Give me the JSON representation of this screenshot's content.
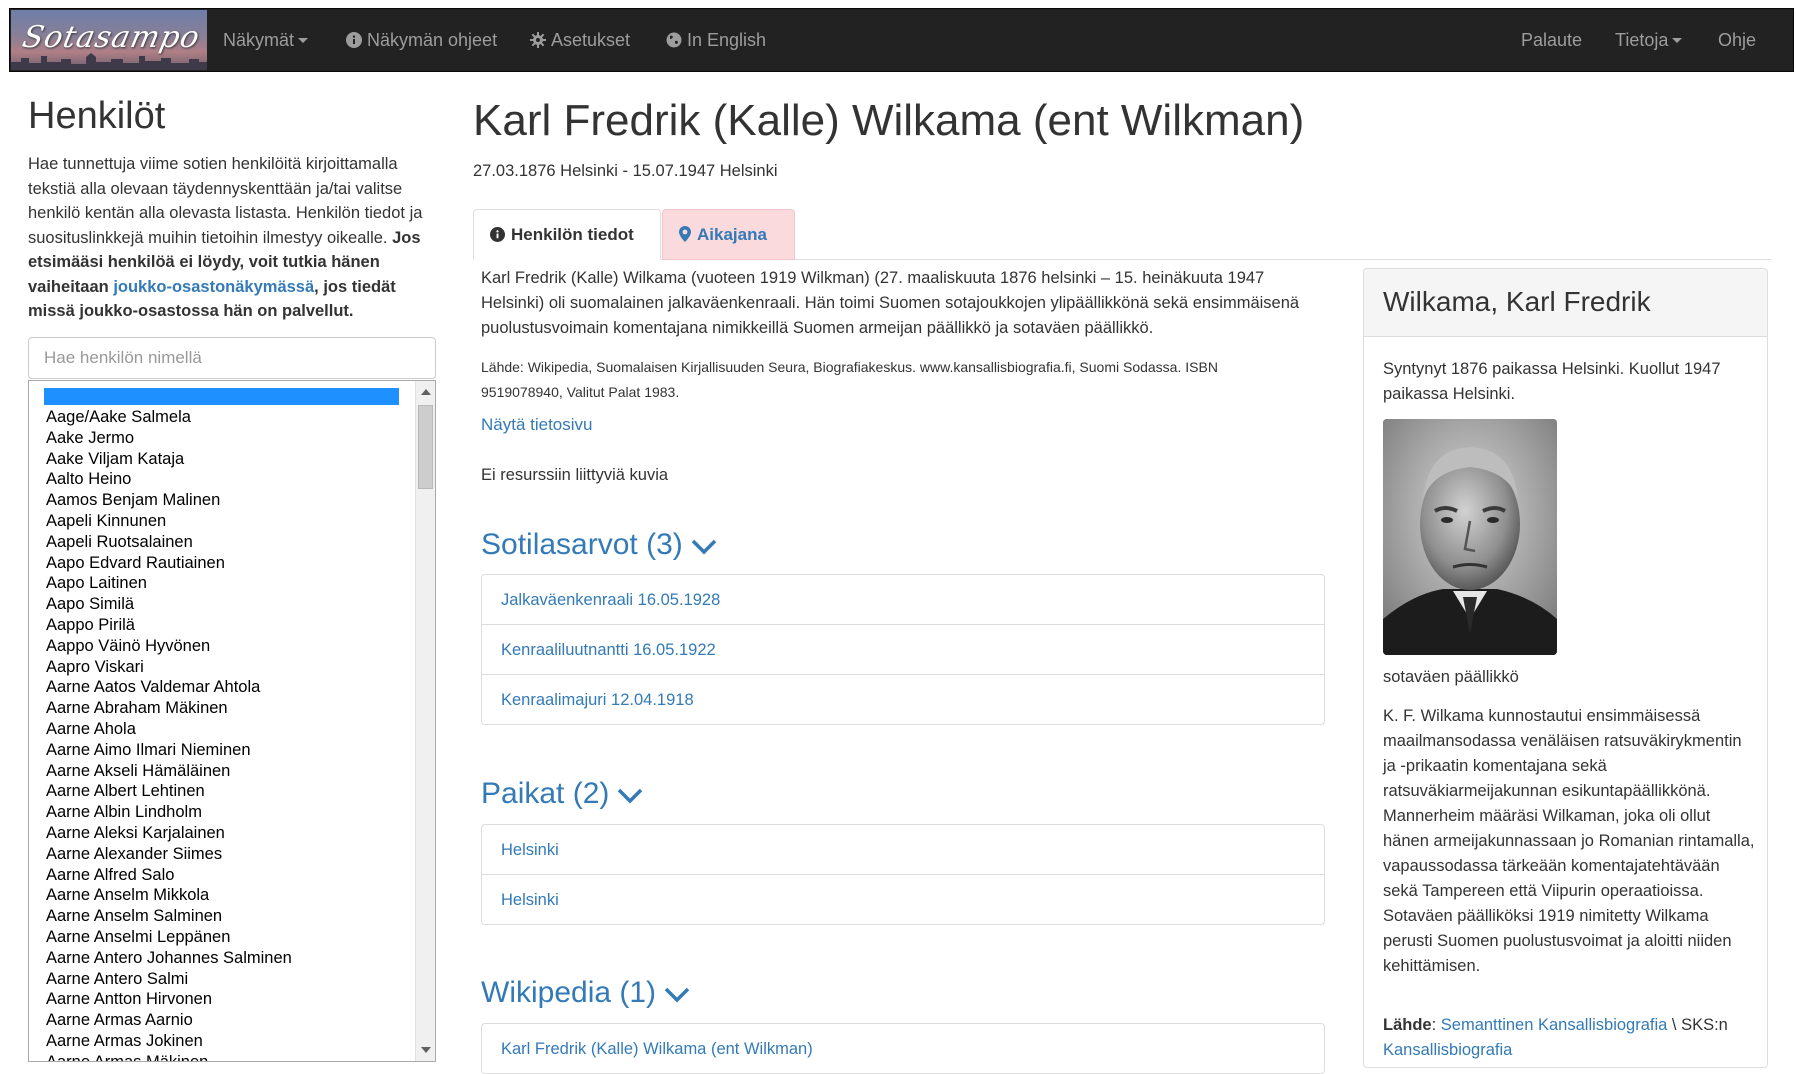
{
  "navbar": {
    "logo_text": "Sotasampo",
    "views_label": "Näkymät",
    "instructions_label": "Näkymän ohjeet",
    "settings_label": "Asetukset",
    "english_label": "In English",
    "feedback_label": "Palaute",
    "info_label": "Tietoja",
    "help_label": "Ohje"
  },
  "left": {
    "title": "Henkilöt",
    "intro_text": "Hae tunnettuja viime sotien henkilöitä kirjoittamalla tekstiä alla olevaan täydennyskenttään ja/tai valitse henkilö kentän alla olevasta listasta. Henkilön tiedot ja suosituslinkkejä muihin tietoihin ilmestyy oikealle.",
    "intro_bold_1": "Jos etsimääsi henkilöä ei löydy, voit tutkia hänen vaiheitaan",
    "intro_link": "joukko-osastonäkymässä",
    "intro_bold_2": ", jos tiedät missä joukko-osastossa hän on palvellut.",
    "search_placeholder": "Hae henkilön nimellä",
    "persons": [
      "Aage/Aake Salmela",
      "Aake Jermo",
      "Aake Viljam Kataja",
      "Aalto Heino",
      "Aamos Benjam Malinen",
      "Aapeli Kinnunen",
      "Aapeli Ruotsalainen",
      "Aapo Edvard Rautiainen",
      "Aapo Laitinen",
      "Aapo Similä",
      "Aappo Pirilä",
      "Aappo Väinö Hyvönen",
      "Aapro Viskari",
      "Aarne Aatos Valdemar Ahtola",
      "Aarne Abraham Mäkinen",
      "Aarne Ahola",
      "Aarne Aimo Ilmari Nieminen",
      "Aarne Akseli Hämäläinen",
      "Aarne Albert Lehtinen",
      "Aarne Albin Lindholm",
      "Aarne Aleksi Karjalainen",
      "Aarne Alexander Siimes",
      "Aarne Alfred Salo",
      "Aarne Anselm Mikkola",
      "Aarne Anselm Salminen",
      "Aarne Anselmi Leppänen",
      "Aarne Antero Johannes Salminen",
      "Aarne Antero Salmi",
      "Aarne Antton Hirvonen",
      "Aarne Armas Aarnio",
      "Aarne Armas Jokinen",
      "Aarne Armas Mäkinen"
    ]
  },
  "person": {
    "name": "Karl Fredrik (Kalle) Wilkama (ent Wilkman)",
    "dates": "27.03.1876 Helsinki - 15.07.1947 Helsinki",
    "tab_info": "Henkilön tiedot",
    "tab_timeline": "Aikajana",
    "summary": "Karl Fredrik (Kalle) Wilkama (vuoteen 1919 Wilkman) (27. maaliskuuta 1876 helsinki – 15. heinäkuuta 1947 Helsinki) oli suomalainen jalkaväenkenraali. Hän toimi Suomen sotajoukkojen ylipäällikkönä sekä ensimmäisenä puolustusvoimain komentajana nimikkeillä Suomen armeijan päällikkö ja sotaväen päällikkö.",
    "source": "Lähde: Wikipedia, Suomalaisen Kirjallisuuden Seura, Biografiakeskus. www.kansallisbiografia.fi, Suomi Sodassa. ISBN 9519078940, Valitut Palat 1983.",
    "show_page": "Näytä tietosivu",
    "no_images": "Ei resurssiin liittyviä kuvia"
  },
  "sections": {
    "ranks": {
      "title": "Sotilasarvot (3)",
      "items": [
        "Jalkaväenkenraali 16.05.1928",
        "Kenraaliluutnantti 16.05.1922",
        "Kenraalimajuri 12.04.1918"
      ]
    },
    "places": {
      "title": "Paikat (2)",
      "items": [
        "Helsinki",
        "Helsinki"
      ]
    },
    "wikipedia": {
      "title": "Wikipedia (1)",
      "items": [
        "Karl Fredrik (Kalle) Wilkama (ent Wilkman)"
      ]
    }
  },
  "card": {
    "title": "Wilkama, Karl Fredrik",
    "born": "Syntynyt 1876 paikassa Helsinki. Kuollut 1947 paikassa Helsinki.",
    "caption": "sotaväen päällikkö",
    "bio": "K. F. Wilkama kunnostautui ensimmäisessä maailmansodassa venäläisen ratsuväkirykmentin ja -prikaatin komentajana sekä ratsuväkiarmeijakunnan esikuntapäällikkönä. Mannerheim määräsi Wilkaman, joka oli ollut hänen armeijakunnassaan jo Romanian rintamalla, vapaussodassa tärkeään komentajatehtävään sekä Tampereen että Viipurin operaatioissa. Sotaväen päälliköksi 1919 nimitetty Wilkama perusti Suomen puolustusvoimat ja aloitti niiden kehittämisen.",
    "sources_label": "Lähde",
    "source_link_1": "Semanttinen Kansallisbiografia",
    "source_sep": " \\ SKS:n ",
    "source_link_2": "Kansallisbiografia"
  },
  "colors": {
    "navbar_bg": "#222222",
    "link": "#337ab7",
    "timeline_tab_bg": "#fadadd",
    "list_selection": "#1e90ff"
  },
  "icons": {
    "instructions": "info-circle-icon",
    "settings": "cog-icon",
    "english": "globe-icon",
    "tab_info": "info-circle-icon",
    "tab_timeline": "map-marker-icon",
    "section_toggle": "chevron-down-icon"
  }
}
